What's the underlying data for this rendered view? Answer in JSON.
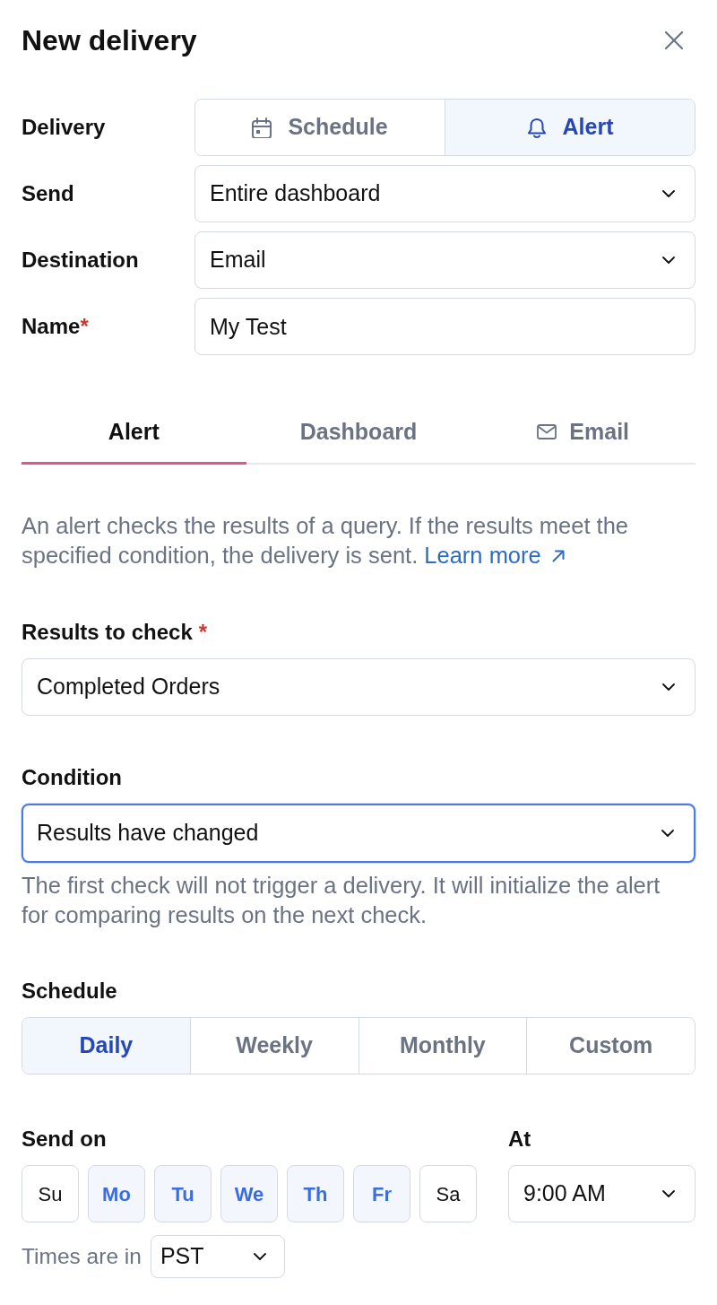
{
  "header": {
    "title": "New delivery"
  },
  "fields": [
    {
      "kind": "segmented",
      "label": "Delivery",
      "options": [
        {
          "label": "Schedule",
          "selected": false
        },
        {
          "label": "Alert",
          "selected": true
        }
      ]
    },
    {
      "kind": "select",
      "label": "Send",
      "value": "Entire dashboard"
    },
    {
      "kind": "select",
      "label": "Destination",
      "value": "Email"
    },
    {
      "kind": "text",
      "label": "Name",
      "required_mark": "*",
      "value": "My Test"
    }
  ],
  "tabs": [
    {
      "label": "Alert",
      "selected": true
    },
    {
      "label": "Dashboard",
      "selected": false
    },
    {
      "label": "Email",
      "selected": false
    }
  ],
  "description": {
    "text": "An alert checks the results of a query. If the results meet the specified condition, the delivery is sent.",
    "link": "Learn more"
  },
  "results_to_check": {
    "label": "Results to check",
    "required_mark": "*",
    "value": "Completed Orders"
  },
  "condition": {
    "label": "Condition",
    "value": "Results have changed",
    "focused": true,
    "help": "The first check will not trigger a delivery. It will initialize the alert for comparing results on the next check."
  },
  "schedule": {
    "label": "Schedule",
    "options": [
      {
        "label": "Daily",
        "selected": true
      },
      {
        "label": "Weekly",
        "selected": false
      },
      {
        "label": "Monthly",
        "selected": false
      },
      {
        "label": "Custom",
        "selected": false
      }
    ]
  },
  "send_on": {
    "label": "Send on",
    "days": [
      {
        "label": "Su",
        "selected": false
      },
      {
        "label": "Mo",
        "selected": true
      },
      {
        "label": "Tu",
        "selected": true
      },
      {
        "label": "We",
        "selected": true
      },
      {
        "label": "Th",
        "selected": true
      },
      {
        "label": "Fr",
        "selected": true
      },
      {
        "label": "Sa",
        "selected": false
      }
    ]
  },
  "at": {
    "label": "At",
    "value": "9:00 AM"
  },
  "timezone": {
    "label": "Times are in",
    "value": "PST"
  }
}
